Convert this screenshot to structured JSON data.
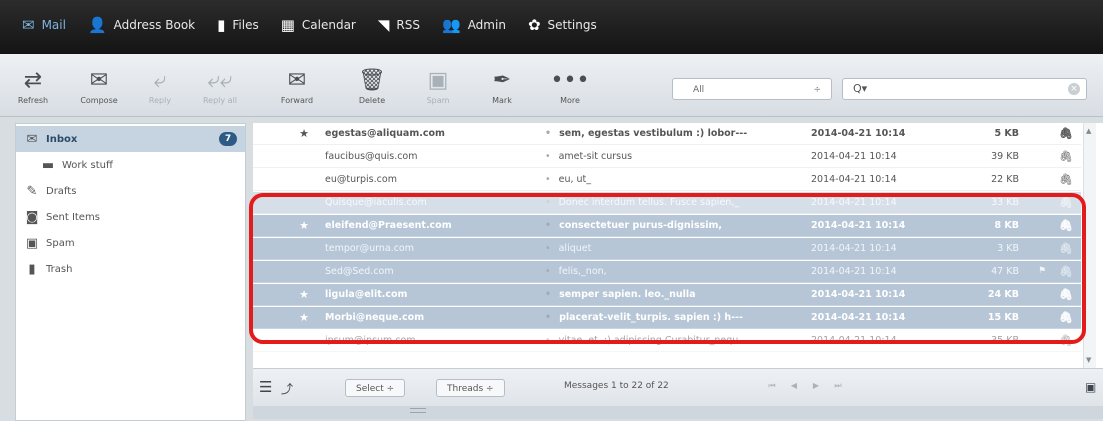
{
  "topnav": [
    {
      "label": "Mail",
      "icon": "envelope-icon",
      "glyph": "✉"
    },
    {
      "label": "Address Book",
      "icon": "person-icon",
      "glyph": "👤"
    },
    {
      "label": "Files",
      "icon": "file-icon",
      "glyph": "▮"
    },
    {
      "label": "Calendar",
      "icon": "calendar-icon",
      "glyph": "▦"
    },
    {
      "label": "RSS",
      "icon": "rss-icon",
      "glyph": "◥"
    },
    {
      "label": "Admin",
      "icon": "admin-icon",
      "glyph": "👥"
    },
    {
      "label": "Settings",
      "icon": "gear-icon",
      "glyph": "✿"
    }
  ],
  "toolbar": {
    "refresh": "Refresh",
    "compose": "Compose",
    "reply": "Reply",
    "reply_all": "Reply all",
    "forward": "Forward",
    "delete": "Delete",
    "spam": "Spam",
    "mark": "Mark",
    "more": "More",
    "filter_value": "All",
    "search_placeholder": "Q▾"
  },
  "folders": [
    {
      "label": "Inbox",
      "icon": "inbox-icon",
      "glyph": "✉",
      "badge": "7",
      "selected": true
    },
    {
      "label": "Work stuff",
      "icon": "folder-icon",
      "glyph": "▬",
      "sub": true
    },
    {
      "label": "Drafts",
      "icon": "pencil-icon",
      "glyph": "✎"
    },
    {
      "label": "Sent Items",
      "icon": "sent-icon",
      "glyph": "◙"
    },
    {
      "label": "Spam",
      "icon": "spam-icon",
      "glyph": "▣"
    },
    {
      "label": "Trash",
      "icon": "trash-icon",
      "glyph": "▮"
    }
  ],
  "messages": [
    {
      "star": "★",
      "from": "egestas@aliquam.com",
      "subject": "sem, egestas vestibulum :) lobor---",
      "date": "2014-04-21 10:14",
      "size": "5 KB",
      "flag": "",
      "attach": true,
      "bold": true,
      "selected": false
    },
    {
      "star": "",
      "from": "faucibus@quis.com",
      "subject": "amet-sit cursus",
      "date": "2014-04-21 10:14",
      "size": "39 KB",
      "flag": "",
      "attach": true,
      "bold": false,
      "selected": false
    },
    {
      "star": "",
      "from": "eu@turpis.com",
      "subject": "eu, ut_",
      "date": "2014-04-21 10:14",
      "size": "22 KB",
      "flag": "",
      "attach": true,
      "bold": false,
      "selected": false
    },
    {
      "star": "",
      "from": "Quisque@iaculis.com",
      "subject": "Donec interdum tellus. Fusce sapien,_",
      "date": "2014-04-21 10:14",
      "size": "33 KB",
      "flag": "",
      "attach": true,
      "bold": false,
      "selected": true
    },
    {
      "star": "★",
      "from": "eleifend@Praesent.com",
      "subject": "consectetuer purus-dignissim,",
      "date": "2014-04-21 10:14",
      "size": "8 KB",
      "flag": "",
      "attach": true,
      "bold": true,
      "selected": true
    },
    {
      "star": "",
      "from": "tempor@urna.com",
      "subject": "aliquet",
      "date": "2014-04-21 10:14",
      "size": "3 KB",
      "flag": "",
      "attach": true,
      "bold": false,
      "selected": true
    },
    {
      "star": "",
      "from": "Sed@Sed.com",
      "subject": "felis,_non,",
      "date": "2014-04-21 10:14",
      "size": "47 KB",
      "flag": "⚑",
      "attach": true,
      "bold": false,
      "selected": true
    },
    {
      "star": "★",
      "from": "ligula@elit.com",
      "subject": "semper sapien. leo._nulla",
      "date": "2014-04-21 10:14",
      "size": "24 KB",
      "flag": "",
      "attach": true,
      "bold": true,
      "selected": true
    },
    {
      "star": "★",
      "from": "Morbi@neque.com",
      "subject": "placerat-velit_turpis. sapien :) h---",
      "date": "2014-04-21 10:14",
      "size": "15 KB",
      "flag": "",
      "attach": true,
      "bold": true,
      "selected": true
    },
    {
      "star": "",
      "from": "ipsum@ipsum.com",
      "subject": "vitae, et, :) adipiscing Curabitur_nequ",
      "date": "2014-04-21 10:14",
      "size": "35 KB",
      "flag": "",
      "attach": true,
      "bold": false,
      "selected": false
    }
  ],
  "footer": {
    "select_label": "Select ÷",
    "threads_label": "Threads ÷",
    "status": "Messages 1 to 22 of 22"
  },
  "colors": {
    "accent": "#2e5a86",
    "highlight": "#e31b1b",
    "selection": "#b6c6d6"
  }
}
